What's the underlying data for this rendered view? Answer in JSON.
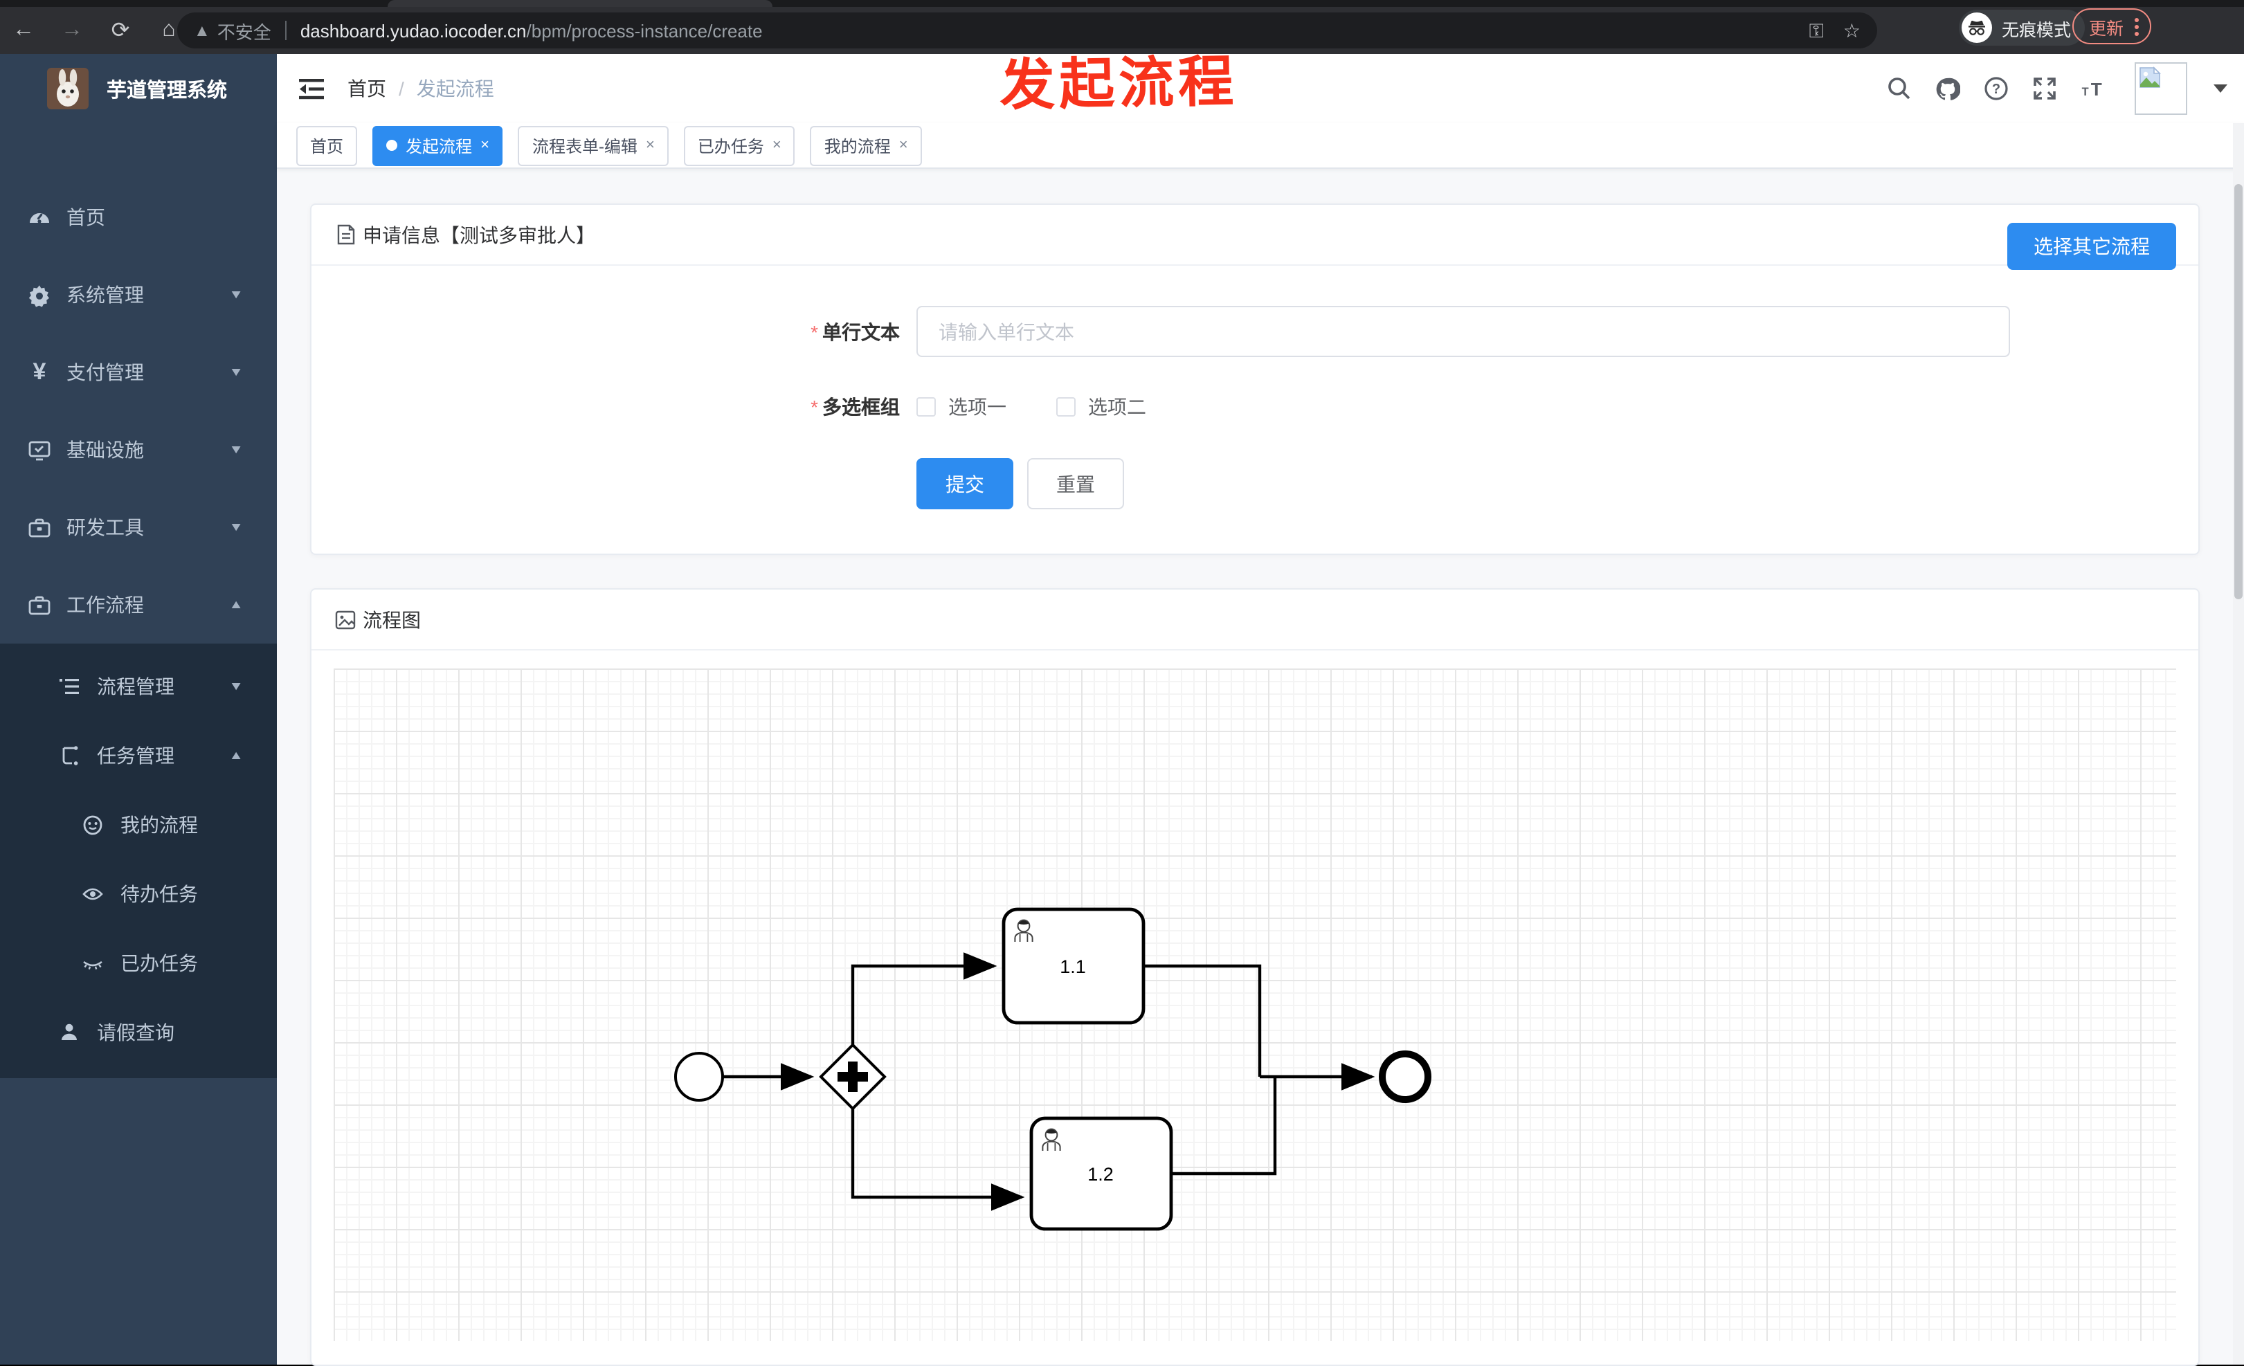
{
  "browser": {
    "security_label": "不安全",
    "url_domain": "dashboard.yudao.iocoder.cn",
    "url_path": "/bpm/process-instance/create",
    "incognito_label": "无痕模式",
    "update_label": "更新"
  },
  "sidebar": {
    "logo_title": "芋道管理系统",
    "items": [
      {
        "label": "首页",
        "icon": "dashboard-icon",
        "chevron": ""
      },
      {
        "label": "系统管理",
        "icon": "gear-icon",
        "chevron": "down"
      },
      {
        "label": "支付管理",
        "icon": "yen-icon",
        "chevron": "down"
      },
      {
        "label": "基础设施",
        "icon": "monitor-icon",
        "chevron": "down"
      },
      {
        "label": "研发工具",
        "icon": "toolbox-icon",
        "chevron": "down"
      },
      {
        "label": "工作流程",
        "icon": "briefcase-icon",
        "chevron": "up"
      }
    ],
    "submenu": [
      {
        "label": "流程管理",
        "icon": "list-icon",
        "chevron": "down"
      },
      {
        "label": "任务管理",
        "icon": "flow-icon",
        "chevron": "up"
      },
      {
        "label": "我的流程",
        "icon": "face-icon",
        "chevron": ""
      },
      {
        "label": "待办任务",
        "icon": "eye-icon",
        "chevron": ""
      },
      {
        "label": "已办任务",
        "icon": "eye-closed-icon",
        "chevron": ""
      },
      {
        "label": "请假查询",
        "icon": "person-icon",
        "chevron": ""
      }
    ]
  },
  "header": {
    "breadcrumb": [
      "首页",
      "发起流程"
    ],
    "separator": "/",
    "annotation": "发起流程"
  },
  "ui": {
    "close_glyph": "×",
    "chevron_down": "⌄",
    "chevron_up": "⌃",
    "required_mark": "*"
  },
  "tabs": [
    {
      "label": "首页"
    },
    {
      "label": "发起流程"
    },
    {
      "label": "流程表单-编辑"
    },
    {
      "label": "已办任务"
    },
    {
      "label": "我的流程"
    }
  ],
  "apply_card": {
    "title": "申请信息【测试多审批人】",
    "choose_button": "选择其它流程",
    "text_field": {
      "label": "单行文本",
      "placeholder": "请输入单行文本",
      "value": ""
    },
    "checkbox_group": {
      "label": "多选框组",
      "options": [
        {
          "label": "选项一",
          "checked": false
        },
        {
          "label": "选项二",
          "checked": false
        }
      ]
    },
    "submit_label": "提交",
    "reset_label": "重置"
  },
  "diagram_card": {
    "title": "流程图",
    "nodes": {
      "start": "start-event",
      "gateway": "parallel-gateway",
      "task1": "1.1",
      "task2": "1.2",
      "end": "end-event"
    }
  },
  "colors": {
    "accent": "#2d8cf0",
    "annotation_red": "#f8321b",
    "sidebar_bg": "#304156",
    "submenu_bg": "#1f2d3d",
    "update_red": "#f28b82"
  }
}
